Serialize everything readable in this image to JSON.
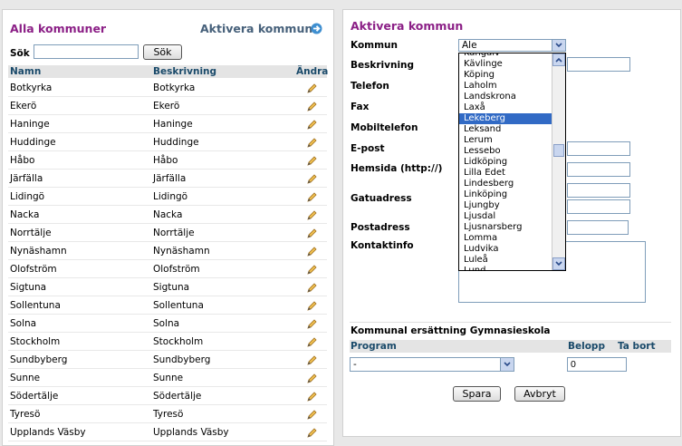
{
  "left": {
    "title": "Alla kommuner",
    "activate_link": "Aktivera kommun",
    "search": {
      "label": "Sök",
      "value": "",
      "button": "Sök"
    },
    "columns": [
      "Namn",
      "Beskrivning",
      "Ändra"
    ],
    "rows": [
      {
        "name": "Botkyrka",
        "desc": "Botkyrka"
      },
      {
        "name": "Ekerö",
        "desc": "Ekerö"
      },
      {
        "name": "Haninge",
        "desc": "Haninge"
      },
      {
        "name": "Huddinge",
        "desc": "Huddinge"
      },
      {
        "name": "Håbo",
        "desc": "Håbo"
      },
      {
        "name": "Järfälla",
        "desc": "Järfälla"
      },
      {
        "name": "Lidingö",
        "desc": "Lidingö"
      },
      {
        "name": "Nacka",
        "desc": "Nacka"
      },
      {
        "name": "Norrtälje",
        "desc": "Norrtälje"
      },
      {
        "name": "Nynäshamn",
        "desc": "Nynäshamn"
      },
      {
        "name": "Olofström",
        "desc": "Olofström"
      },
      {
        "name": "Sigtuna",
        "desc": "Sigtuna"
      },
      {
        "name": "Sollentuna",
        "desc": "Sollentuna"
      },
      {
        "name": "Solna",
        "desc": "Solna"
      },
      {
        "name": "Stockholm",
        "desc": "Stockholm"
      },
      {
        "name": "Sundbyberg",
        "desc": "Sundbyberg"
      },
      {
        "name": "Sunne",
        "desc": "Sunne"
      },
      {
        "name": "Södertälje",
        "desc": "Södertälje"
      },
      {
        "name": "Tyresö",
        "desc": "Tyresö"
      },
      {
        "name": "Upplands Väsby",
        "desc": "Upplands Väsby"
      }
    ]
  },
  "right": {
    "title": "Aktivera kommun",
    "labels": {
      "kommun": "Kommun",
      "beskrivning": "Beskrivning",
      "telefon": "Telefon",
      "fax": "Fax",
      "mobil": "Mobiltelefon",
      "epost": "E-post",
      "hemsida": "Hemsida (http://)",
      "gatuadress": "Gatuadress",
      "postadress": "Postadress",
      "kontaktinfo": "Kontaktinfo"
    },
    "kommun_selected": "Ale",
    "dropdown_options": [
      "Kungälv",
      "Kävlinge",
      "Köping",
      "Laholm",
      "Landskrona",
      "Laxå",
      "Lekeberg",
      "Leksand",
      "Lerum",
      "Lessebo",
      "Lidköping",
      "Lilla Edet",
      "Lindesberg",
      "Linköping",
      "Ljungby",
      "Ljusdal",
      "Ljusnarsberg",
      "Lomma",
      "Ludvika",
      "Luleå",
      "Lund"
    ],
    "highlighted_option": "Lekeberg",
    "gymnasieskola": {
      "title": "Kommunal ersättning Gymnasieskola",
      "col_program": "Program",
      "col_belopp": "Belopp",
      "col_tabort": "Ta bort",
      "program_value": "-",
      "belopp_value": "0"
    },
    "save_button": "Spara",
    "cancel_button": "Avbryt"
  },
  "colors": {
    "title": "#8b1f86",
    "link": "#46607a",
    "selection": "#316ac5"
  },
  "icons": {
    "activate": "arrow-right-icon",
    "edit": "pencil-icon",
    "dropdown": "chevron-down-icon"
  }
}
